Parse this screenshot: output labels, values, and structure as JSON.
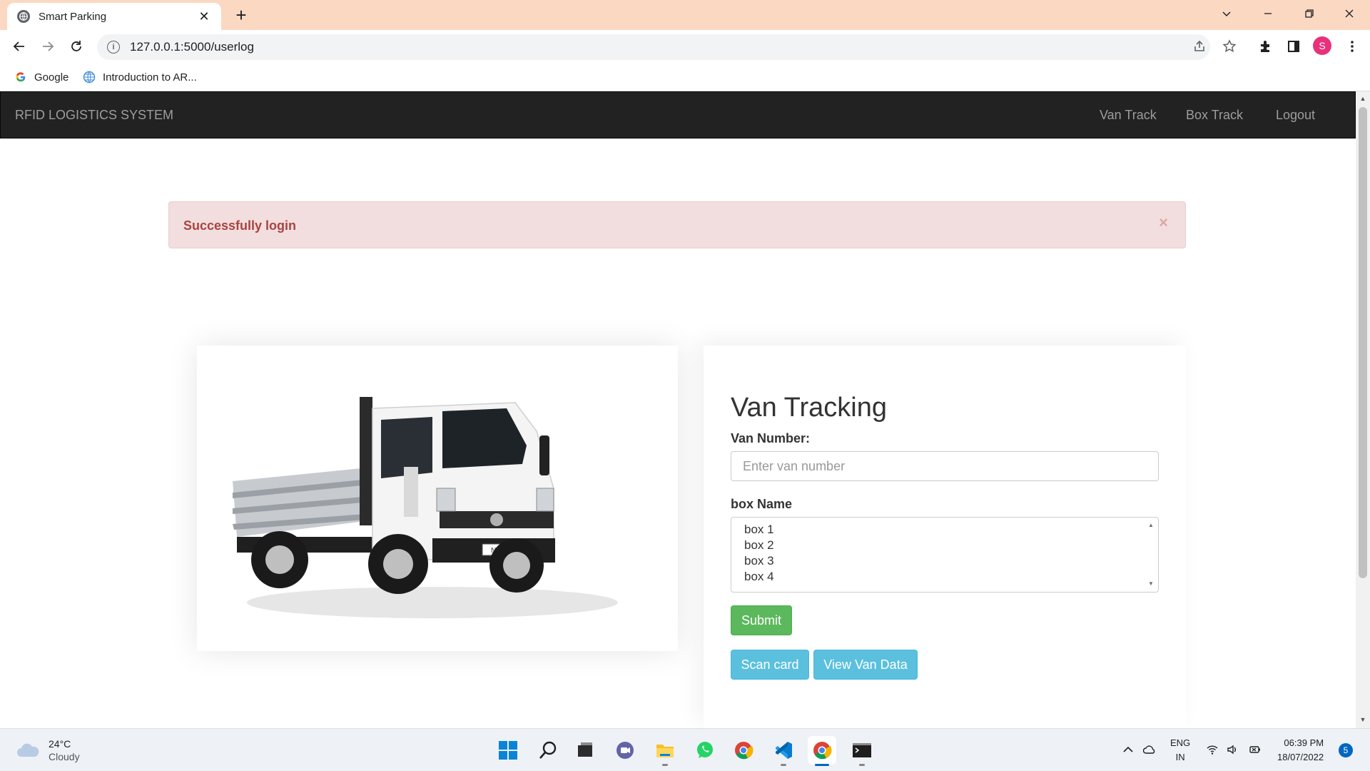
{
  "browser": {
    "tab_title": "Smart Parking",
    "tab_close": "✕",
    "new_tab": "+",
    "url": "127.0.0.1:5000/userlog",
    "profile_initial": "S",
    "profile_color": "#e8317a",
    "bookmarks": [
      {
        "label": "Google",
        "icon": "google-icon"
      },
      {
        "label": "Introduction to AR...",
        "icon": "globe-icon"
      }
    ]
  },
  "navbar": {
    "brand": "RFID LOGISTICS SYSTEM",
    "links": [
      "Van Track",
      "Box Track",
      "Logout"
    ],
    "background": "#222222"
  },
  "alert": {
    "message": "Successfully login",
    "close": "×",
    "background": "#f2dede",
    "text_color": "#a94442"
  },
  "image": {
    "plate": "NT400"
  },
  "form": {
    "title": "Van Tracking",
    "van_number_label": "Van Number:",
    "van_number_placeholder": "Enter van number",
    "van_number_value": "",
    "box_name_label": "box Name",
    "box_options": [
      "box 1",
      "box 2",
      "box 3",
      "box 4"
    ],
    "submit_label": "Submit",
    "scan_label": "Scan card",
    "view_label": "View Van Data",
    "colors": {
      "success": "#5cb85c",
      "info": "#5bc0de"
    }
  },
  "taskbar": {
    "weather_temp": "24°C",
    "weather_desc": "Cloudy",
    "lang_line1": "ENG",
    "lang_line2": "IN",
    "time": "06:39 PM",
    "date": "18/07/2022",
    "notification_count": "5"
  }
}
